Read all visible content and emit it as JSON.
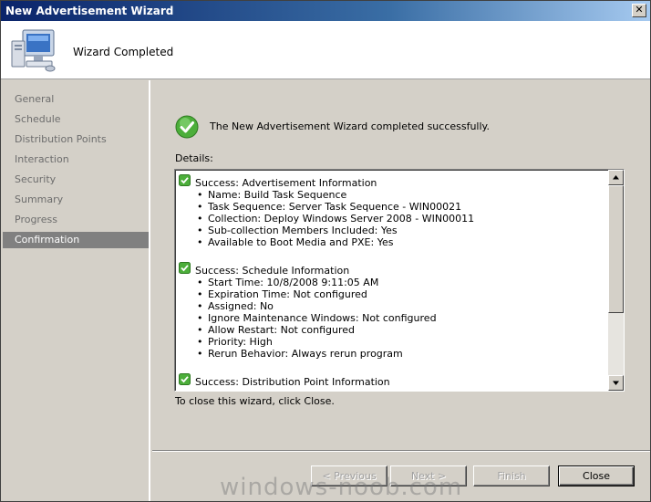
{
  "window": {
    "title": "New Advertisement Wizard",
    "close_glyph": "✕"
  },
  "header": {
    "title": "Wizard Completed",
    "icon": "computer-icon"
  },
  "sidebar": {
    "items": [
      {
        "label": "General"
      },
      {
        "label": "Schedule"
      },
      {
        "label": "Distribution Points"
      },
      {
        "label": "Interaction"
      },
      {
        "label": "Security"
      },
      {
        "label": "Summary"
      },
      {
        "label": "Progress"
      },
      {
        "label": "Confirmation",
        "active": true
      }
    ]
  },
  "main": {
    "success_message": "The New Advertisement Wizard completed successfully.",
    "details_label": "Details:",
    "close_hint": "To close this wizard, click Close."
  },
  "details": {
    "sections": [
      {
        "heading": "Success: Advertisement Information",
        "items": [
          "Name: Build Task Sequence",
          "Task Sequence: Server Task Sequence - WIN00021",
          "Collection: Deploy Windows Server 2008 - WIN00011",
          "Sub-collection Members Included: Yes",
          "Available to Boot Media and PXE: Yes"
        ]
      },
      {
        "heading": "Success: Schedule Information",
        "items": [
          "Start Time: 10/8/2008 9:11:05 AM",
          "Expiration Time: Not configured",
          "Assigned: No",
          "Ignore Maintenance Windows: Not configured",
          "Allow Restart: Not configured",
          "Priority: High",
          "Rerun Behavior: Always rerun program"
        ]
      },
      {
        "heading": "Success: Distribution Point Information",
        "items": []
      }
    ]
  },
  "buttons": {
    "previous": "< Previous",
    "next": "Next >",
    "finish": "Finish",
    "close": "Close"
  },
  "watermark": "windows-noob.com",
  "colors": {
    "accent": "#0a246a",
    "success": "#3a9a2a",
    "active_item_bg": "#808080"
  }
}
